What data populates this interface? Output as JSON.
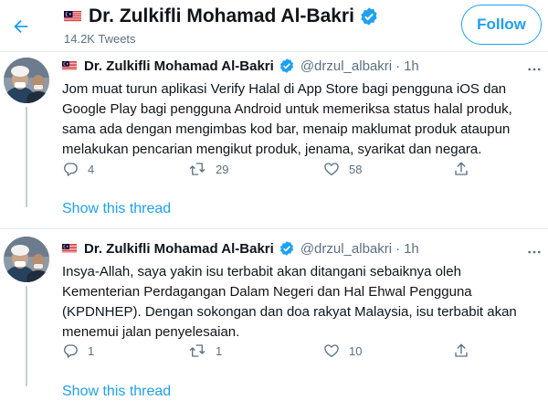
{
  "header": {
    "back_icon": "arrow-left-icon",
    "flag_icon": "malaysia-flag-icon",
    "name": "Dr. Zulkifli Mohamad Al-Bakri",
    "verified_icon": "verified-badge-icon",
    "tweet_count": "14.2K Tweets",
    "follow_label": "Follow"
  },
  "tweets": [
    {
      "name": "Dr. Zulkifli Mohamad Al-Bakri",
      "handle": "@drzul_albakri",
      "dot": "·",
      "time": "1h",
      "text": "Jom muat turun aplikasi Verify Halal di App Store bagi pengguna iOS dan Google Play bagi pengguna Android untuk memeriksa status halal produk, sama ada dengan mengimbas kod bar, menaip maklumat produk ataupun melakukan pencarian mengikut produk, jenama, syarikat dan negara.",
      "replies": "4",
      "retweets": "29",
      "likes": "58",
      "show_thread": "Show this thread"
    },
    {
      "name": "Dr. Zulkifli Mohamad Al-Bakri",
      "handle": "@drzul_albakri",
      "dot": "·",
      "time": "1h",
      "text": "Insya-Allah, saya yakin isu terbabit akan ditangani sebaiknya oleh Kementerian Perdagangan Dalam Negeri dan Hal Ehwal Pengguna (KPDNHEP). Dengan sokongan dan doa rakyat Malaysia, isu terbabit akan menemui jalan penyelesaian.",
      "replies": "1",
      "retweets": "1",
      "likes": "10",
      "show_thread": "Show this thread"
    }
  ],
  "colors": {
    "accent": "#1da1f2",
    "text": "#0f1419",
    "secondary": "#5b7083",
    "divider": "#e6ecf0"
  }
}
